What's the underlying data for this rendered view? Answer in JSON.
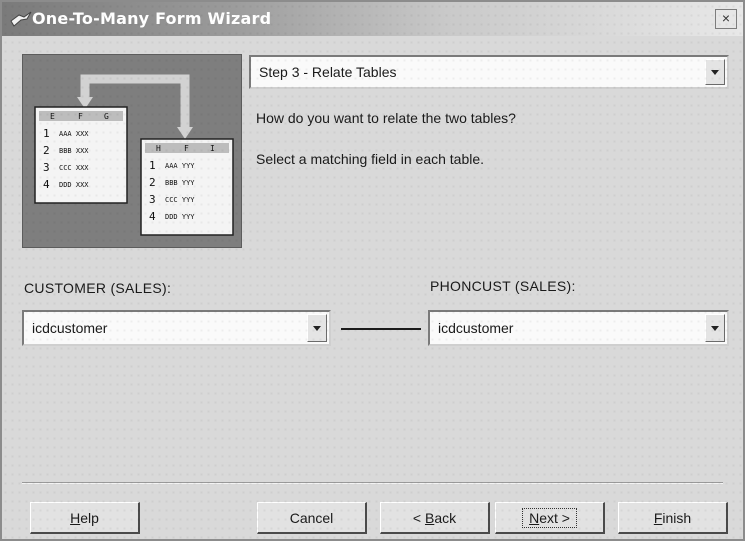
{
  "window": {
    "title": "One-To-Many Form Wizard",
    "close_glyph": "×"
  },
  "illustration": {
    "left_table": {
      "headers": [
        "E",
        "F",
        "G"
      ],
      "rows": [
        {
          "num": "1",
          "data": "AAA XXX"
        },
        {
          "num": "2",
          "data": "BBB XXX"
        },
        {
          "num": "3",
          "data": "CCC XXX"
        },
        {
          "num": "4",
          "data": "DDD XXX"
        }
      ]
    },
    "right_table": {
      "headers": [
        "H",
        "F",
        "I"
      ],
      "rows": [
        {
          "num": "1",
          "data": "AAA YYY"
        },
        {
          "num": "2",
          "data": "BBB YYY"
        },
        {
          "num": "3",
          "data": "CCC YYY"
        },
        {
          "num": "4",
          "data": "DDD YYY"
        }
      ]
    }
  },
  "step": {
    "selected": "Step 3 - Relate Tables"
  },
  "instructions": {
    "question": "How do you want to relate the two tables?",
    "hint": "Select a matching field in each table."
  },
  "left": {
    "label": "CUSTOMER (SALES):",
    "selected": "icdcustomer"
  },
  "right": {
    "label": "PHONCUST (SALES):",
    "selected": "icdcustomer"
  },
  "buttons": {
    "help": {
      "accel": "H",
      "rest": "elp"
    },
    "cancel": "Cancel",
    "back": {
      "prefix": "< ",
      "accel": "B",
      "rest": "ack"
    },
    "next": {
      "accel": "N",
      "rest": "ext >"
    },
    "finish": {
      "accel": "F",
      "rest": "inish"
    }
  },
  "icons": {
    "title": "wizard-wand-icon",
    "dropdown": "chevron-down-icon",
    "illustration": "relate-tables-illustration"
  }
}
